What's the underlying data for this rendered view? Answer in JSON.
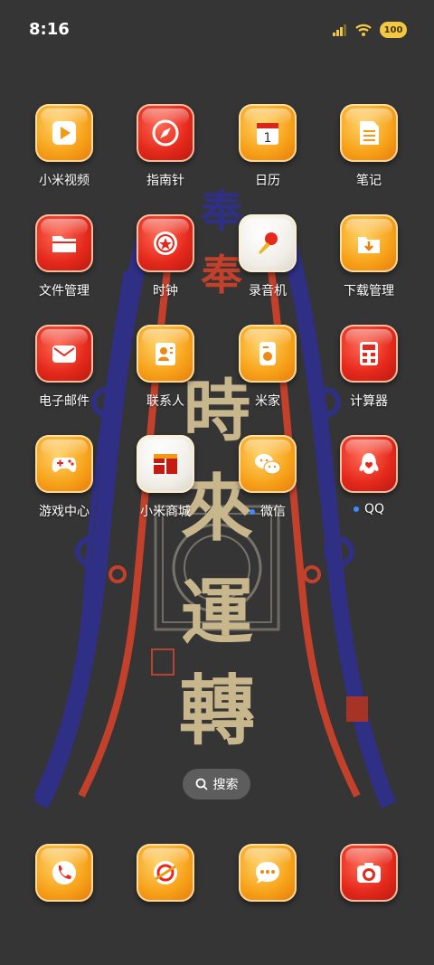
{
  "status_bar": {
    "time": "8:16",
    "battery": "100"
  },
  "wallpaper": {
    "text": [
      "時",
      "來",
      "運",
      "轉"
    ],
    "top_text": [
      "奉",
      "奉"
    ]
  },
  "apps": [
    {
      "label": "小米视频",
      "icon": "video-play-icon"
    },
    {
      "label": "指南针",
      "icon": "compass-icon"
    },
    {
      "label": "日历",
      "icon": "calendar-icon",
      "day": "1"
    },
    {
      "label": "笔记",
      "icon": "notes-icon"
    },
    {
      "label": "文件管理",
      "icon": "folder-icon"
    },
    {
      "label": "时钟",
      "icon": "clock-icon"
    },
    {
      "label": "录音机",
      "icon": "microphone-icon"
    },
    {
      "label": "下载管理",
      "icon": "download-icon"
    },
    {
      "label": "电子邮件",
      "icon": "mail-icon"
    },
    {
      "label": "联系人",
      "icon": "contacts-icon"
    },
    {
      "label": "米家",
      "icon": "mihome-icon"
    },
    {
      "label": "计算器",
      "icon": "calculator-icon"
    },
    {
      "label": "游戏中心",
      "icon": "gamepad-icon"
    },
    {
      "label": "小米商城",
      "icon": "store-icon"
    },
    {
      "label": "微信",
      "icon": "wechat-icon",
      "new": true
    },
    {
      "label": "QQ",
      "icon": "qq-icon",
      "new": true
    }
  ],
  "search": {
    "label": "搜索"
  },
  "dock": [
    {
      "icon": "phone-icon"
    },
    {
      "icon": "browser-icon"
    },
    {
      "icon": "messages-icon"
    },
    {
      "icon": "camera-icon"
    }
  ]
}
